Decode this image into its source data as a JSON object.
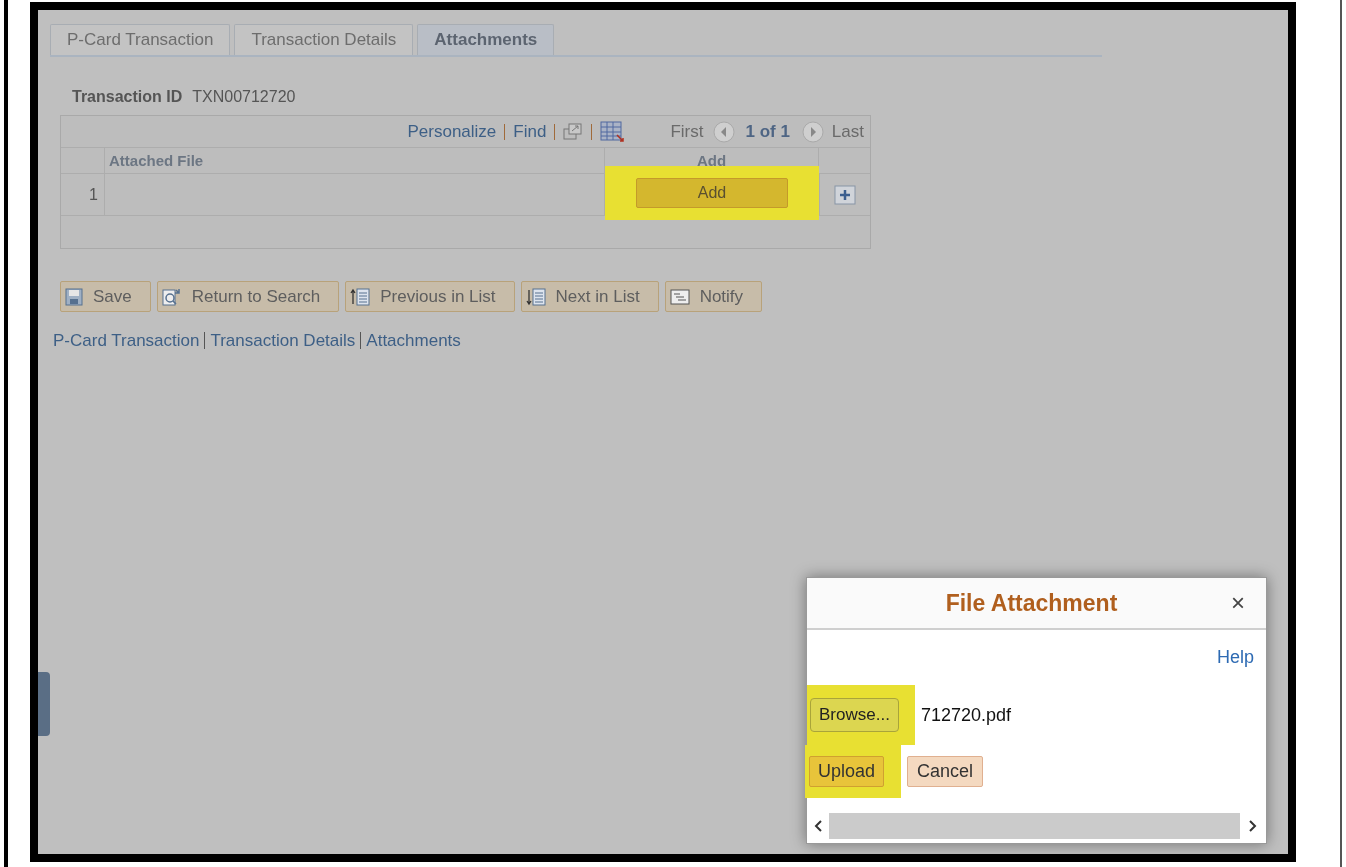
{
  "tabs": [
    {
      "label": "P-Card Transaction",
      "selected": false
    },
    {
      "label": "Transaction Details",
      "selected": false
    },
    {
      "label": "Attachments",
      "selected": true
    }
  ],
  "transaction": {
    "label": "Transaction ID",
    "value": "TXN00712720"
  },
  "grid": {
    "toolbar": {
      "personalize": "Personalize",
      "find": "Find",
      "first": "First",
      "count": "1 of 1",
      "last": "Last"
    },
    "columns": [
      "Attached File",
      "Add"
    ],
    "rows": [
      {
        "number": "1",
        "add_button": "Add",
        "highlighted": true
      }
    ]
  },
  "buttons": [
    {
      "kind": "save",
      "label": "Save"
    },
    {
      "kind": "search",
      "label": "Return to Search"
    },
    {
      "kind": "previous",
      "label": "Previous in List"
    },
    {
      "kind": "next",
      "label": "Next in List"
    },
    {
      "kind": "notify",
      "label": "Notify"
    }
  ],
  "footer_links": [
    "P-Card Transaction",
    "Transaction Details",
    "Attachments"
  ],
  "dialog": {
    "title": "File Attachment",
    "close": "×",
    "help": "Help",
    "browse": {
      "label": "Browse...",
      "highlighted": true
    },
    "file_name": "712720.pdf",
    "upload": {
      "label": "Upload",
      "highlighted": true
    },
    "cancel": "Cancel"
  }
}
